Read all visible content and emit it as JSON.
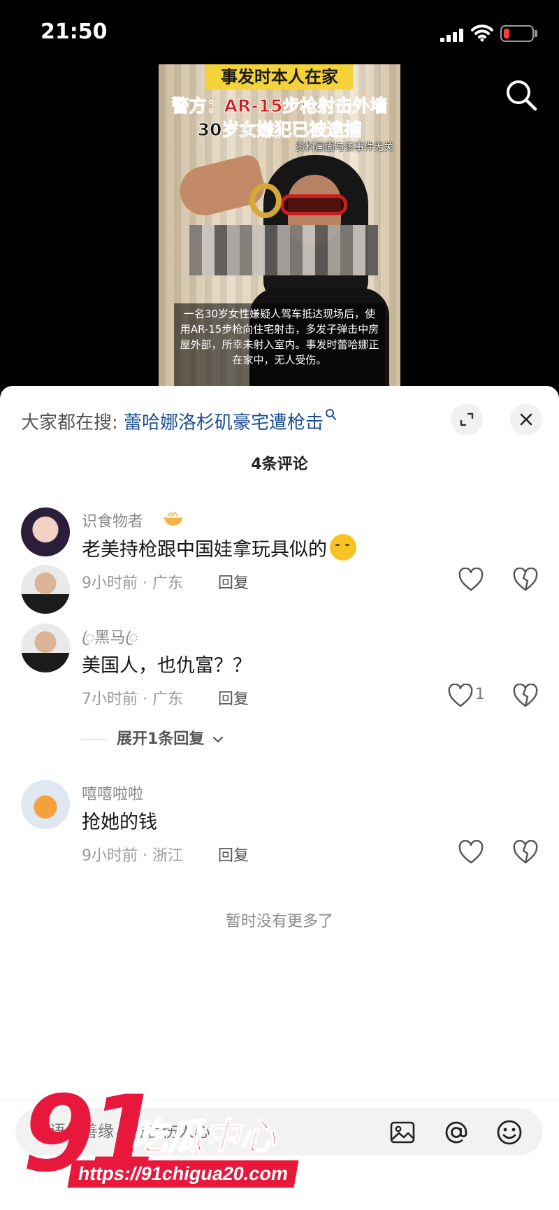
{
  "status_bar": {
    "time": "21:50"
  },
  "video": {
    "banner": "事发时本人在家",
    "headline_line1": "警方：AR-15步枪射击外墙",
    "headline_line2": "30岁女嫌犯已被逮捕",
    "disclaimer": "资料画面与该事件无关",
    "caption": "一名30岁女性嫌疑人驾车抵达现场后，使用AR-15步枪向住宅射击，多发子弹击中房屋外部，所幸未射入室内。事发时蕾哈娜正在家中，无人受伤。"
  },
  "sheet": {
    "hot_search_prefix": "大家都在搜:",
    "hot_search_term": "蕾哈娜洛杉矶豪宅遭枪击",
    "comment_count": "4条评论",
    "reply_label": "回复",
    "expand_replies": "展开1条回复",
    "end_text": "暂时没有更多了"
  },
  "comments": [
    {
      "user": "识食物者",
      "text": "老美持枪跟中国娃拿玩具似的",
      "meta": "9小时前 · 广东",
      "likes": ""
    },
    {
      "user": "ꦿ黑马ꦿ",
      "text": "美国人，也仇富？？",
      "meta": "7小时前 · 广东",
      "likes": "1"
    },
    {
      "user": "嘻嘻啦啦",
      "text": "抢她的钱",
      "meta": "9小时前 · 浙江",
      "likes": ""
    }
  ],
  "input": {
    "placeholder": "善语结善缘，恶言伤人心"
  },
  "watermark": {
    "brand_number": "91",
    "brand_name": "吃瓜中心",
    "url": "https://91chigua20.com"
  },
  "colors": {
    "accent_red": "#e8183c",
    "link_blue": "#1d4f91",
    "sheet_bg": "#ffffff"
  },
  "icons": [
    "search-icon",
    "expand-icon",
    "close-icon",
    "heart-icon",
    "broken-heart-icon",
    "image-icon",
    "at-icon",
    "emoji-icon"
  ]
}
